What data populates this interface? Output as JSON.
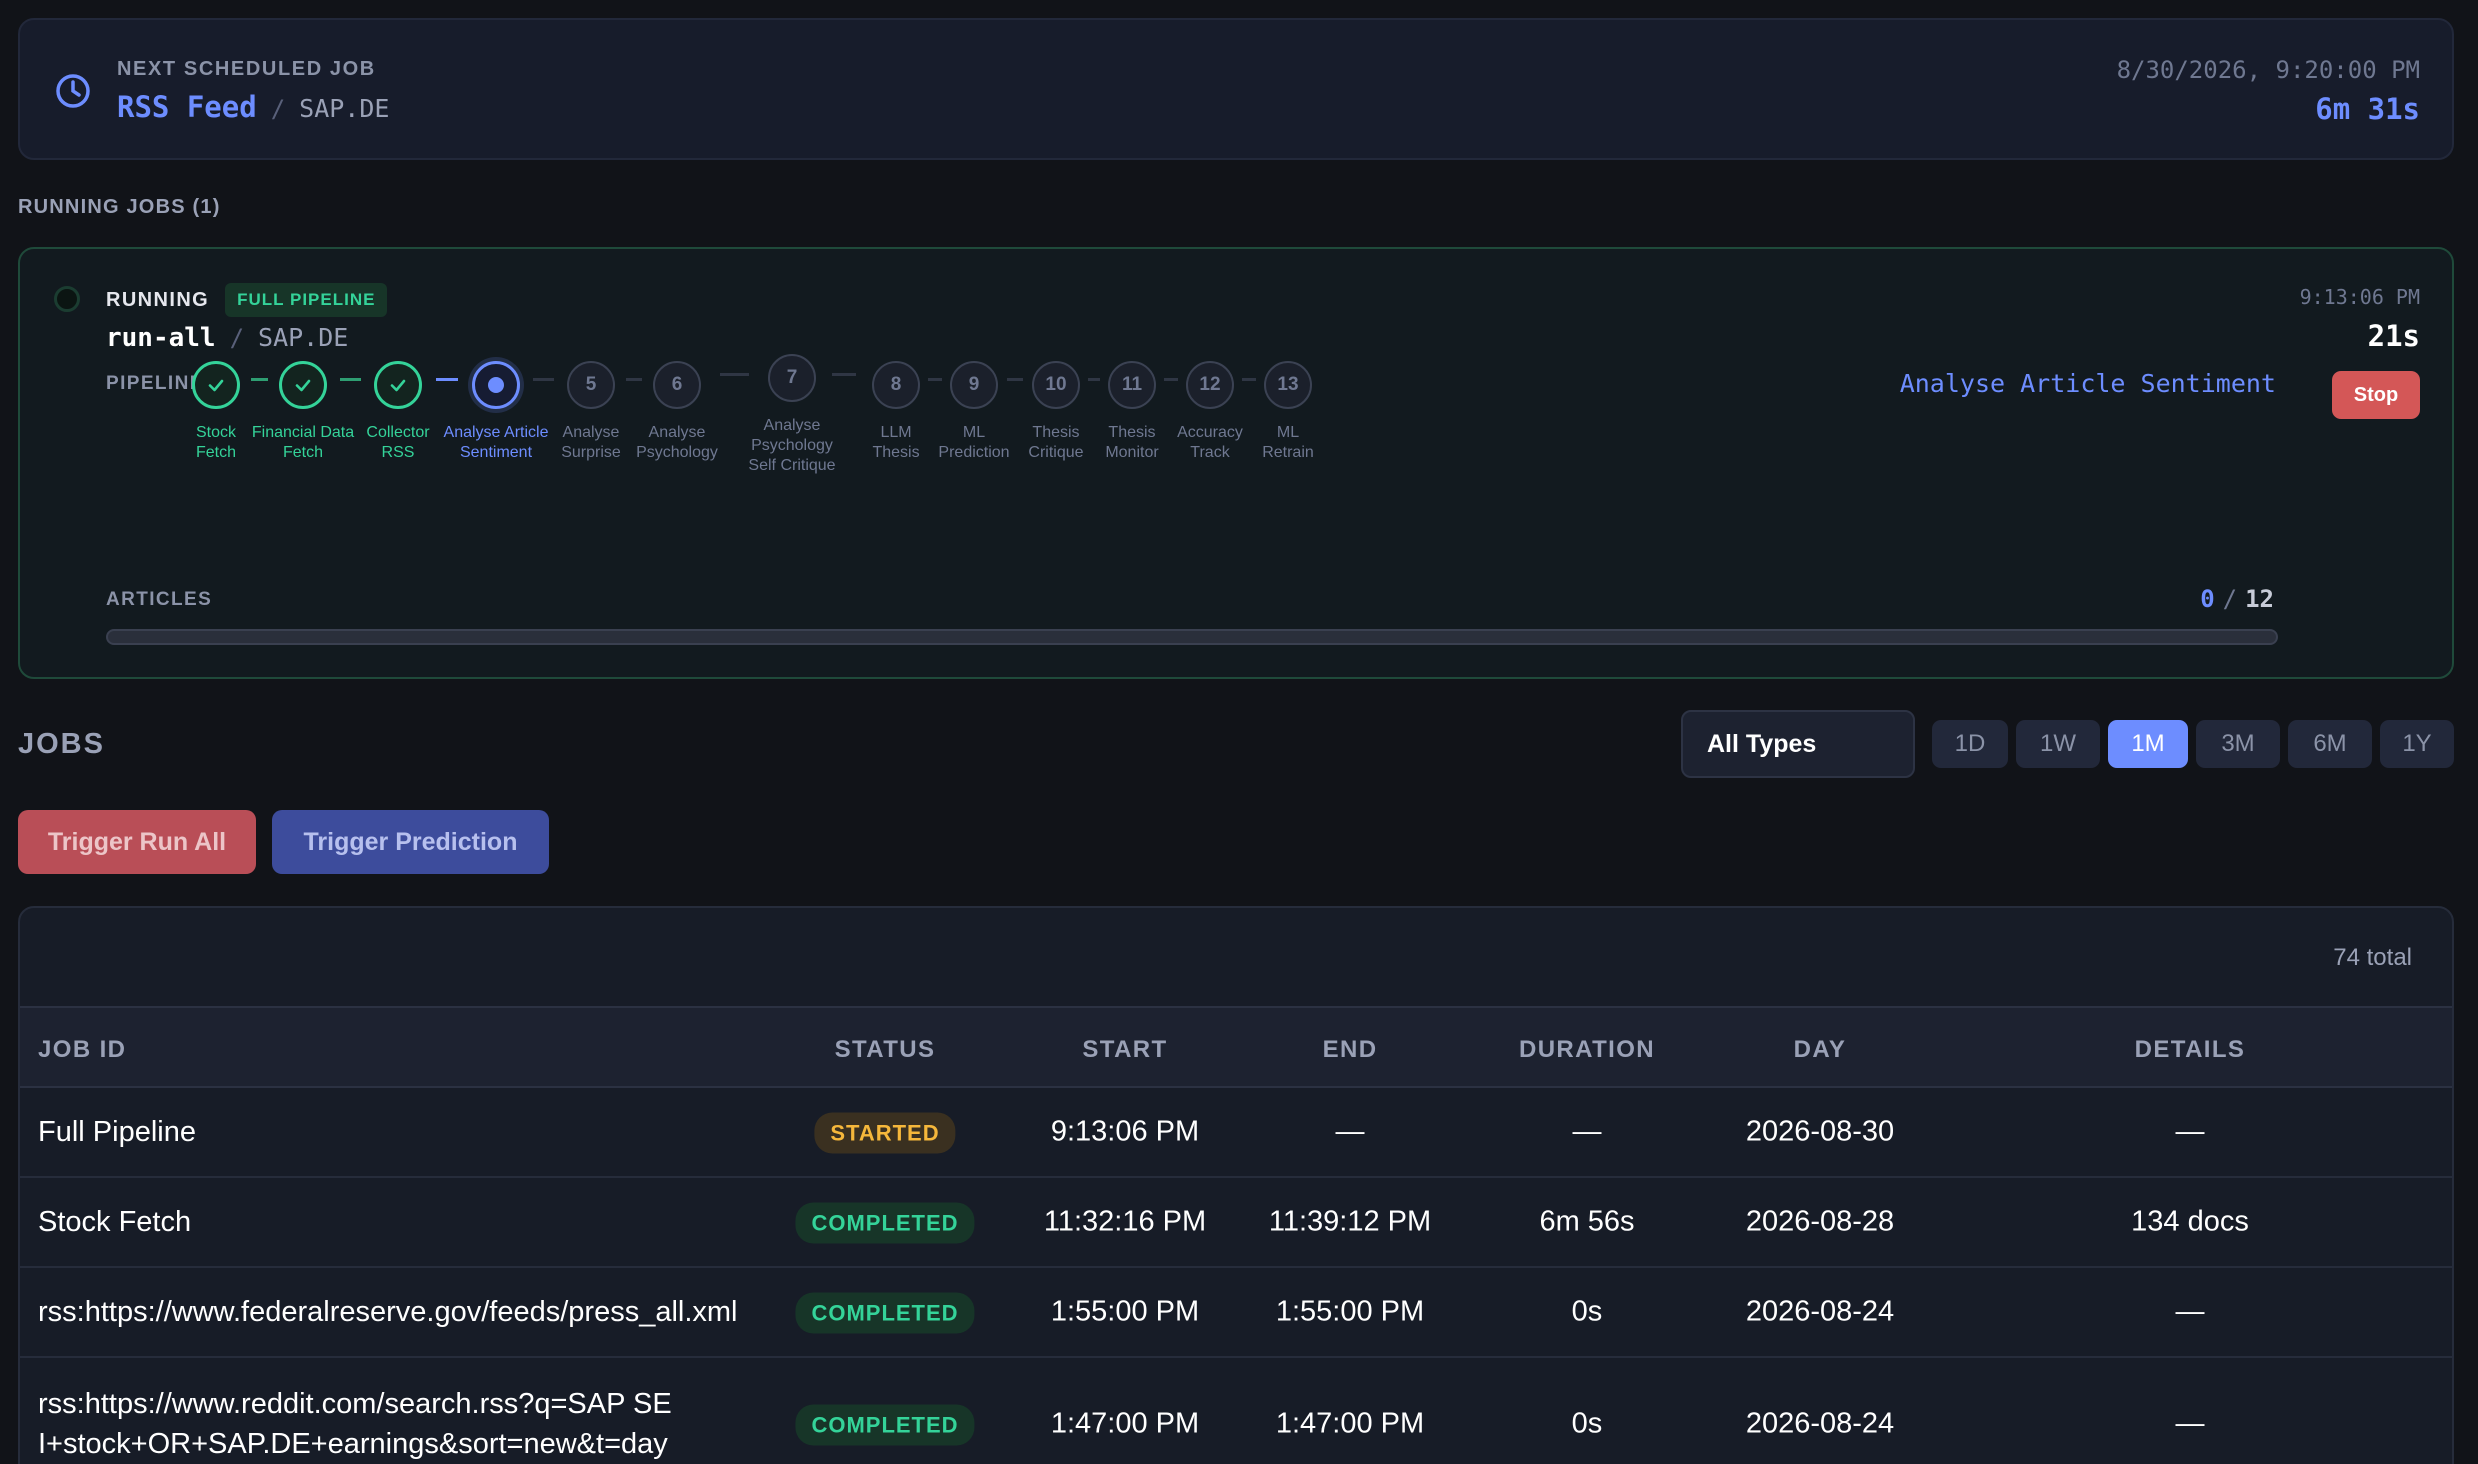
{
  "next_job": {
    "label": "NEXT SCHEDULED JOB",
    "job": "RSS Feed",
    "separator": "/",
    "symbol": "SAP.DE",
    "datetime": "8/30/2026, 9:20:00 PM",
    "countdown": "6m 31s"
  },
  "running_section": {
    "label": "RUNNING JOBS (1)"
  },
  "running_job": {
    "status": "RUNNING",
    "badge": "FULL PIPELINE",
    "job": "run-all",
    "separator": "/",
    "symbol": "SAP.DE",
    "start_time": "9:13:06 PM",
    "elapsed": "21s",
    "pipeline_label": "PIPELINE",
    "current_step": "Analyse Article Sentiment",
    "stop_label": "Stop",
    "steps": [
      {
        "num": "1",
        "label": "Stock\nFetch",
        "state": "done"
      },
      {
        "num": "2",
        "label": "Financial Data\nFetch",
        "state": "done"
      },
      {
        "num": "3",
        "label": "Collector\nRSS",
        "state": "done"
      },
      {
        "num": "4",
        "label": "Analyse Article\nSentiment",
        "state": "active"
      },
      {
        "num": "5",
        "label": "Analyse\nSurprise",
        "state": "pending"
      },
      {
        "num": "6",
        "label": "Analyse\nPsychology",
        "state": "pending"
      },
      {
        "num": "7",
        "label": "Analyse\nPsychology\nSelf Critique",
        "state": "pending"
      },
      {
        "num": "8",
        "label": "LLM\nThesis",
        "state": "pending"
      },
      {
        "num": "9",
        "label": "ML\nPrediction",
        "state": "pending"
      },
      {
        "num": "10",
        "label": "Thesis\nCritique",
        "state": "pending"
      },
      {
        "num": "11",
        "label": "Thesis\nMonitor",
        "state": "pending"
      },
      {
        "num": "12",
        "label": "Accuracy\nTrack",
        "state": "pending"
      },
      {
        "num": "13",
        "label": "ML\nRetrain",
        "state": "pending"
      }
    ],
    "articles_label": "ARTICLES",
    "articles_done": "0",
    "articles_sep": "/",
    "articles_total": "12",
    "articles_progress": 0
  },
  "jobs": {
    "title": "JOBS",
    "type_filter": "All Types",
    "ranges": [
      "1D",
      "1W",
      "1M",
      "3M",
      "6M",
      "1Y"
    ],
    "active_range": "1M",
    "trigger_run_all": "Trigger Run All",
    "trigger_prediction": "Trigger Prediction",
    "total": "74 total",
    "columns": [
      "JOB ID",
      "STATUS",
      "START",
      "END",
      "DURATION",
      "DAY",
      "DETAILS"
    ],
    "rows": [
      {
        "job_id": "Full Pipeline",
        "status": "STARTED",
        "start": "9:13:06 PM",
        "end": "—",
        "duration": "—",
        "day": "2026-08-30",
        "details": "—"
      },
      {
        "job_id": "Stock Fetch",
        "status": "COMPLETED",
        "start": "11:32:16 PM",
        "end": "11:39:12 PM",
        "duration": "6m 56s",
        "day": "2026-08-28",
        "details": "134 docs"
      },
      {
        "job_id": "rss:https://www.federalreserve.gov/feeds/press_all.xml",
        "status": "COMPLETED",
        "start": "1:55:00 PM",
        "end": "1:55:00 PM",
        "duration": "0s",
        "day": "2026-08-24",
        "details": "—"
      },
      {
        "job_id": "rss:https://www.reddit.com/search.rss?q=SAP SE\nI+stock+OR+SAP.DE+earnings&sort=new&t=day",
        "status": "COMPLETED",
        "start": "1:47:00 PM",
        "end": "1:47:00 PM",
        "duration": "0s",
        "day": "2026-08-24",
        "details": "—"
      }
    ]
  },
  "colors": {
    "accent": "#6d8dff",
    "success": "#34d399",
    "warning": "#f5b73b",
    "danger": "#d45757"
  }
}
